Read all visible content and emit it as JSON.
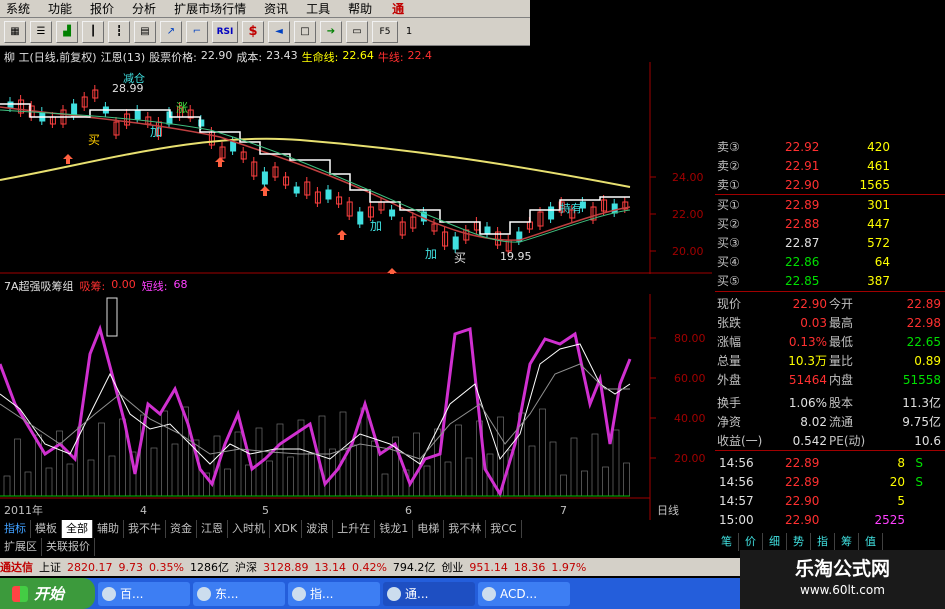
{
  "menu": [
    "系统",
    "功能",
    "报价",
    "分析",
    "扩展市场行情",
    "资讯",
    "工具",
    "帮助"
  ],
  "menu_accent": "通",
  "toolbar": {
    "rsi": "RSI",
    "page_label": "F5",
    "page_num": "1"
  },
  "header": {
    "stock": "柳  工(日线,前复权)",
    "indicator": "江恩(13)",
    "price_label": "股票价格:",
    "price_value": "22.90",
    "cost_label": "成本:",
    "cost_value": "23.43",
    "life_label": "生命线:",
    "life_value": "22.64",
    "bull_label": "牛线:",
    "bull_value": "22.4"
  },
  "main_chart": {
    "y_ticks": [
      "24.00",
      "22.00",
      "20.00"
    ],
    "annotations": {
      "high": "28.99",
      "low": "19.95",
      "reduce": "减仓",
      "buy": "买",
      "add": "加",
      "rise": "涨",
      "hold": "持有"
    }
  },
  "sub_chart": {
    "title": "7A超强吸筹组",
    "absorb_label": "吸筹:",
    "absorb_value": "0.00",
    "short_label": "短线:",
    "short_value": "68",
    "y_ticks": [
      "80.00",
      "60.00",
      "40.00",
      "20.00"
    ],
    "x_labels": [
      "2011年",
      "4",
      "5",
      "6",
      "7"
    ],
    "period": "日线"
  },
  "order_book": [
    {
      "label": "卖③",
      "price": "22.92",
      "volume": "420",
      "color": "#ff3030"
    },
    {
      "label": "卖②",
      "price": "22.91",
      "volume": "461",
      "color": "#ff3030"
    },
    {
      "label": "卖①",
      "price": "22.90",
      "volume": "1565",
      "color": "#ff3030"
    },
    {
      "label": "买①",
      "price": "22.89",
      "volume": "301",
      "color": "#ff3030"
    },
    {
      "label": "买②",
      "price": "22.88",
      "volume": "447",
      "color": "#ff3030"
    },
    {
      "label": "买③",
      "price": "22.87",
      "volume": "572",
      "color": "#e0e0e0"
    },
    {
      "label": "买④",
      "price": "22.86",
      "volume": "64",
      "color": "#00e000"
    },
    {
      "label": "买⑤",
      "price": "22.85",
      "volume": "387",
      "color": "#00e000"
    }
  ],
  "stats": [
    {
      "l1": "现价",
      "v1": "22.90",
      "c1": "#ff3030",
      "l2": "今开",
      "v2": "22.89",
      "c2": "#ff3030"
    },
    {
      "l1": "张跌",
      "v1": "0.03",
      "c1": "#ff3030",
      "l2": "最高",
      "v2": "22.98",
      "c2": "#ff3030"
    },
    {
      "l1": "涨幅",
      "v1": "0.13%",
      "c1": "#ff3030",
      "l2": "最低",
      "v2": "22.65",
      "c2": "#00e000"
    },
    {
      "l1": "总量",
      "v1": "10.3万",
      "c1": "#ffff00",
      "l2": "量比",
      "v2": "0.89",
      "c2": "#ffff00"
    },
    {
      "l1": "外盘",
      "v1": "51464",
      "c1": "#ff3030",
      "l2": "内盘",
      "v2": "51558",
      "c2": "#00e000"
    },
    {
      "l1": "换手",
      "v1": "1.06%",
      "c1": "#e0e0e0",
      "l2": "股本",
      "v2": "11.3亿",
      "c2": "#e0e0e0"
    },
    {
      "l1": "净资",
      "v1": "8.02",
      "c1": "#e0e0e0",
      "l2": "流通",
      "v2": "9.75亿",
      "c2": "#e0e0e0"
    },
    {
      "l1": "收益(一)",
      "v1": "0.542",
      "c1": "#e0e0e0",
      "l2": "PE(动)",
      "v2": "10.6",
      "c2": "#e0e0e0"
    }
  ],
  "ticks": [
    {
      "time": "14:56",
      "price": "22.89",
      "volume": "8",
      "side": "S"
    },
    {
      "time": "14:56",
      "price": "22.89",
      "volume": "20",
      "side": "S"
    },
    {
      "time": "14:57",
      "price": "22.90",
      "volume": "5",
      "side": ""
    },
    {
      "time": "15:00",
      "price": "22.90",
      "volume": "2525",
      "side": ""
    }
  ],
  "panel_tabs": [
    "笔",
    "价",
    "细",
    "势",
    "指",
    "筹",
    "值"
  ],
  "tabs": [
    "指标",
    "模板",
    "全部",
    "辅助",
    "我不牛",
    "资金",
    "江恩",
    "入时机",
    "XDK",
    "波浪",
    "上升在",
    "钱龙1",
    "电梯",
    "我不林",
    "我CC"
  ],
  "tabs_active": "全部",
  "tabs2": [
    "扩展区",
    "关联报价"
  ],
  "status": {
    "brand": "通达信",
    "sh_label": "上证",
    "sh_index": "2820.17",
    "sh_change": "9.73",
    "sh_pct": "0.35%",
    "sh_amount": "1286亿",
    "sz_label": "沪深",
    "sz_index": "3128.89",
    "sz_change": "13.14",
    "sz_pct": "0.42%",
    "sz_amount": "794.2亿",
    "cy_label": "创业",
    "cy_index": "951.14",
    "cy_change": "18.36",
    "cy_pct": "1.97%"
  },
  "taskbar": {
    "start": "开始",
    "tasks": [
      "百...",
      "东...",
      "指...",
      "通...",
      "ACD..."
    ]
  },
  "watermark": {
    "name": "乐淘公式网",
    "url": "www.60lt.com"
  }
}
